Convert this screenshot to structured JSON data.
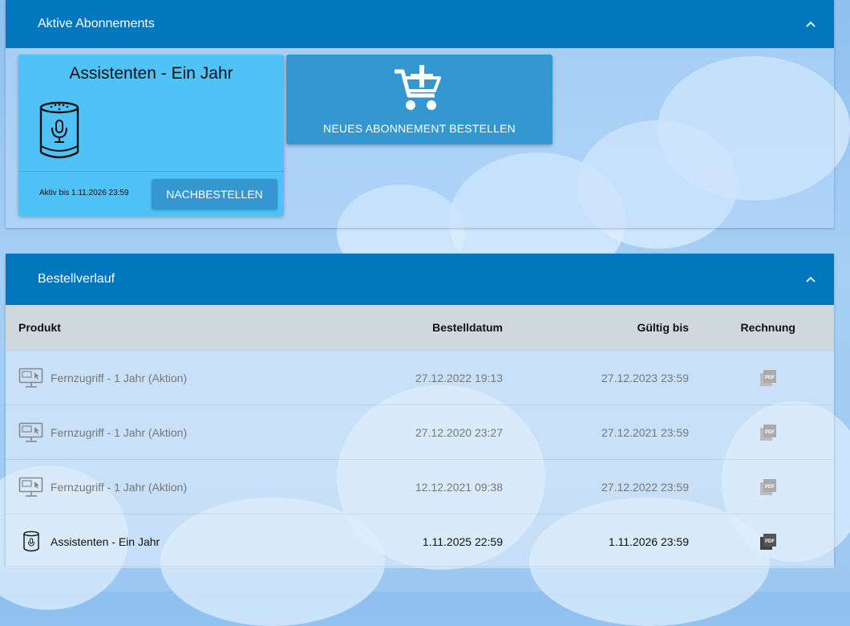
{
  "subscriptions": {
    "title": "Aktive Abonnements",
    "card": {
      "title": "Assistenten - Ein Jahr",
      "active_until": "Aktiv bis 1.11.2026 23:59",
      "reorder_label": "NACHBESTELLEN"
    },
    "new_subscription_label": "NEUES ABONNEMENT BESTELLEN"
  },
  "history": {
    "title": "Bestellverlauf",
    "columns": {
      "product": "Produkt",
      "order_date": "Bestelldatum",
      "valid_until": "Gültig bis",
      "invoice": "Rechnung"
    },
    "rows": [
      {
        "product": "Fernzugriff - 1 Jahr (Aktion)",
        "order_date": "27.12.2022 19:13",
        "valid_until": "27.12.2023 23:59",
        "icon": "monitor-icon"
      },
      {
        "product": "Fernzugriff - 1 Jahr (Aktion)",
        "order_date": "27.12.2020 23:27",
        "valid_until": "27.12.2021 23:59",
        "icon": "monitor-icon"
      },
      {
        "product": "Fernzugriff - 1 Jahr (Aktion)",
        "order_date": "12.12.2021 09:38",
        "valid_until": "27.12.2022 23:59",
        "icon": "monitor-icon"
      },
      {
        "product": "Assistenten - Ein Jahr",
        "order_date": "1.11.2025 22:59",
        "valid_until": "1.11.2026 23:59",
        "icon": "smart-speaker-icon"
      }
    ],
    "pdf_icon_label": "PDF"
  },
  "colors": {
    "header": "#0277bd",
    "card": "#4fc3f7",
    "button": "#3497cf",
    "table_header": "#cfd8dc"
  }
}
